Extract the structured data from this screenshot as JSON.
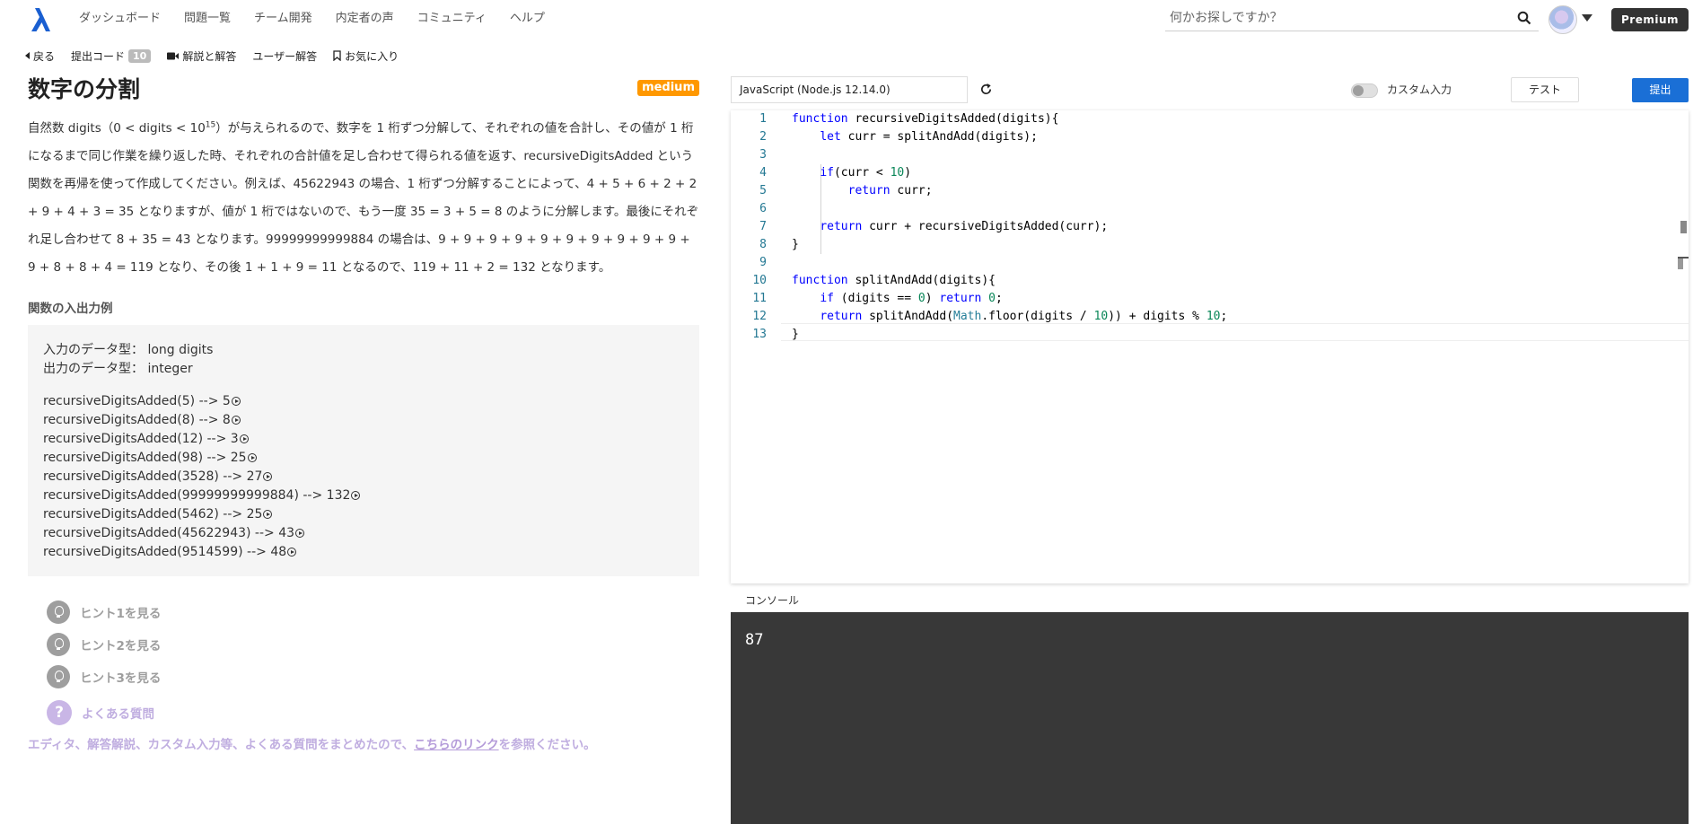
{
  "nav": {
    "links": [
      "ダッシュボード",
      "問題一覧",
      "チーム開発",
      "内定者の声",
      "コミュニティ",
      "ヘルプ"
    ],
    "search_placeholder": "何かお探しですか？",
    "premium_label": "Premium"
  },
  "subnav": {
    "back": "戻る",
    "submission_code": "提出コード",
    "submission_count": "10",
    "explanation": "解説と解答",
    "user_answers": "ユーザー解答",
    "favorite": "お気に入り"
  },
  "problem": {
    "title": "数字の分割",
    "difficulty": "medium",
    "desc_prefix": "自然数 digits（0 < digits < 10",
    "desc_sup": "15",
    "desc_rest": "）が与えられるので、数字を 1 桁ずつ分解して、それぞれの値を合計し、その値が 1 桁になるまで同じ作業を繰り返した時、それぞれの合計値を足し合わせて得られる値を返す、recursiveDigitsAdded という関数を再帰を使って作成してください。例えば、45622943 の場合、1 桁ずつ分解することによって、4 + 5 + 6 + 2 + 2 + 9 + 4 + 3 = 35 となりますが、値が 1 桁ではないので、もう一度 35 = 3 + 5 = 8 のように分解します。最後にそれぞれ足し合わせて 8 + 35 = 43 となります。99999999999884 の場合は、9 + 9 + 9 + 9 + 9 + 9 + 9 + 9 + 9 + 9 + 9 + 8 + 8 + 4 = 119 となり、その後 1 + 1 + 9 = 11 となるので、119 + 11 + 2 = 132 となります。",
    "io_title": "関数の入出力例",
    "input_type": "入力のデータ型： long digits",
    "output_type": "出力のデータ型： integer",
    "examples": [
      "recursiveDigitsAdded(5) --> 5",
      "recursiveDigitsAdded(8) --> 8",
      "recursiveDigitsAdded(12) --> 3",
      "recursiveDigitsAdded(98) --> 25",
      "recursiveDigitsAdded(3528) --> 27",
      "recursiveDigitsAdded(99999999999884) --> 132",
      "recursiveDigitsAdded(5462) --> 25",
      "recursiveDigitsAdded(45622943) --> 43",
      "recursiveDigitsAdded(9514599) --> 48"
    ],
    "hints": [
      "ヒント1を見る",
      "ヒント2を見る",
      "ヒント3を見る"
    ],
    "faq_label": "よくある質問",
    "faq_note_prefix": "エディタ、解答解説、カスタム入力等、よくある質問をまとめたので、",
    "faq_note_link": "こちらのリンク",
    "faq_note_suffix": "を参照ください。"
  },
  "editor": {
    "language": "JavaScript (Node.js 12.14.0)",
    "custom_input_label": "カスタム入力",
    "test_label": "テスト",
    "submit_label": "提出",
    "line_numbers": [
      "1",
      "2",
      "3",
      "4",
      "5",
      "6",
      "7",
      "8",
      "9",
      "10",
      "11",
      "12",
      "13"
    ]
  },
  "console": {
    "label": "コンソール",
    "output": "87"
  },
  "colors": {
    "keyword": "#0000ff",
    "number": "#098658",
    "submit": "#1a6fd6",
    "difficulty": "#ff9800",
    "console_bg": "#383838"
  }
}
